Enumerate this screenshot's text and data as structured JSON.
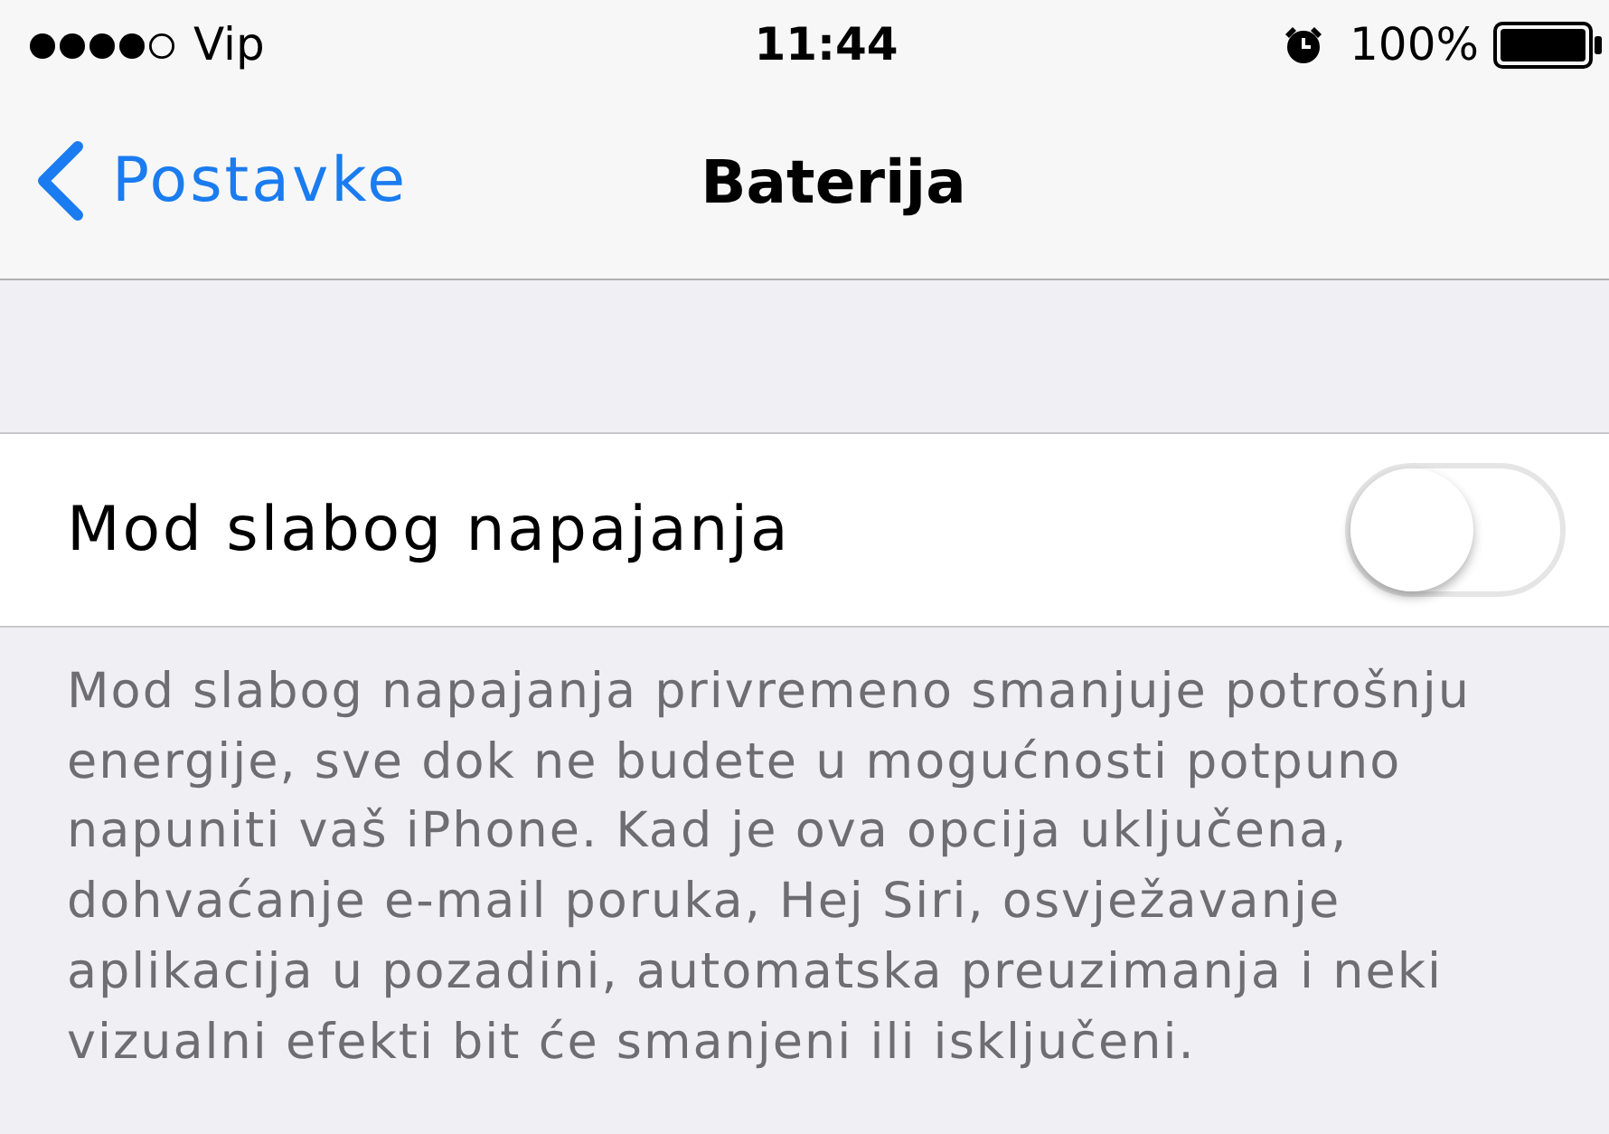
{
  "status_bar": {
    "carrier": "Vip",
    "time": "11:44",
    "battery_percent": "100%"
  },
  "nav_bar": {
    "back_label": "Postavke",
    "title": "Baterija"
  },
  "settings": [
    {
      "kind": "toggle",
      "label": "Mod slabog napajanja",
      "on": false
    }
  ],
  "footer": "Mod slabog napajanja privremeno smanjuje potrošnju energije, sve dok ne budete u mogućnosti potpuno napuniti vaš iPhone. Kad je ova opcija uključena, dohvaćanje e-mail poruka, Hej Siri, osvježavanje aplikacija u pozadini, automatska preuzimanja i neki vizualni efekti bit će smanjeni ili isključeni."
}
